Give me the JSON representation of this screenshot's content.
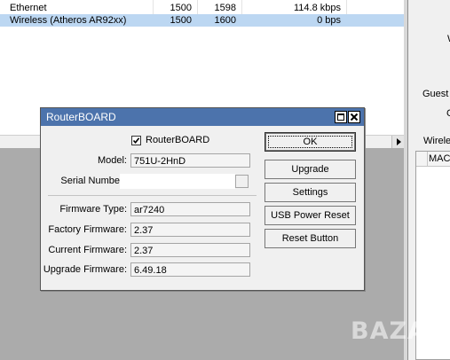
{
  "interfaces": {
    "rows": [
      {
        "name": "Ethernet",
        "mtu": "1500",
        "l2mtu": "1598",
        "rate": "114.8 kbps",
        "selected": false
      },
      {
        "name": "Wireless (Atheros AR92xx)",
        "mtu": "1500",
        "l2mtu": "1600",
        "rate": "0 bps",
        "selected": true
      }
    ]
  },
  "right_pane": {
    "w_label": "W",
    "guest_label": "Guest",
    "c_label": "C",
    "wireless_label": "Wirele",
    "col_mac": "MAC"
  },
  "dialog": {
    "title": "RouterBOARD",
    "routerboard_checkbox_label": "RouterBOARD",
    "routerboard_checked": true,
    "model_label": "Model:",
    "model_value": "751U-2HnD",
    "serial_label": "Serial Numbe",
    "serial_value": "",
    "firmware_type_label": "Firmware Type:",
    "firmware_type_value": "ar7240",
    "factory_firmware_label": "Factory Firmware:",
    "factory_firmware_value": "2.37",
    "current_firmware_label": "Current Firmware:",
    "current_firmware_value": "2.37",
    "upgrade_firmware_label": "Upgrade Firmware:",
    "upgrade_firmware_value": "6.49.18",
    "buttons": {
      "ok": "OK",
      "upgrade": "Upgrade",
      "settings": "Settings",
      "usb_power_reset": "USB Power Reset",
      "reset_button": "Reset Button"
    }
  },
  "watermark": "BAZAR",
  "colors": {
    "titlebar": "#4c73ac",
    "selected_row": "#bcd7f2",
    "desktop": "#ababab",
    "dialog_bg": "#f0f0f0"
  }
}
